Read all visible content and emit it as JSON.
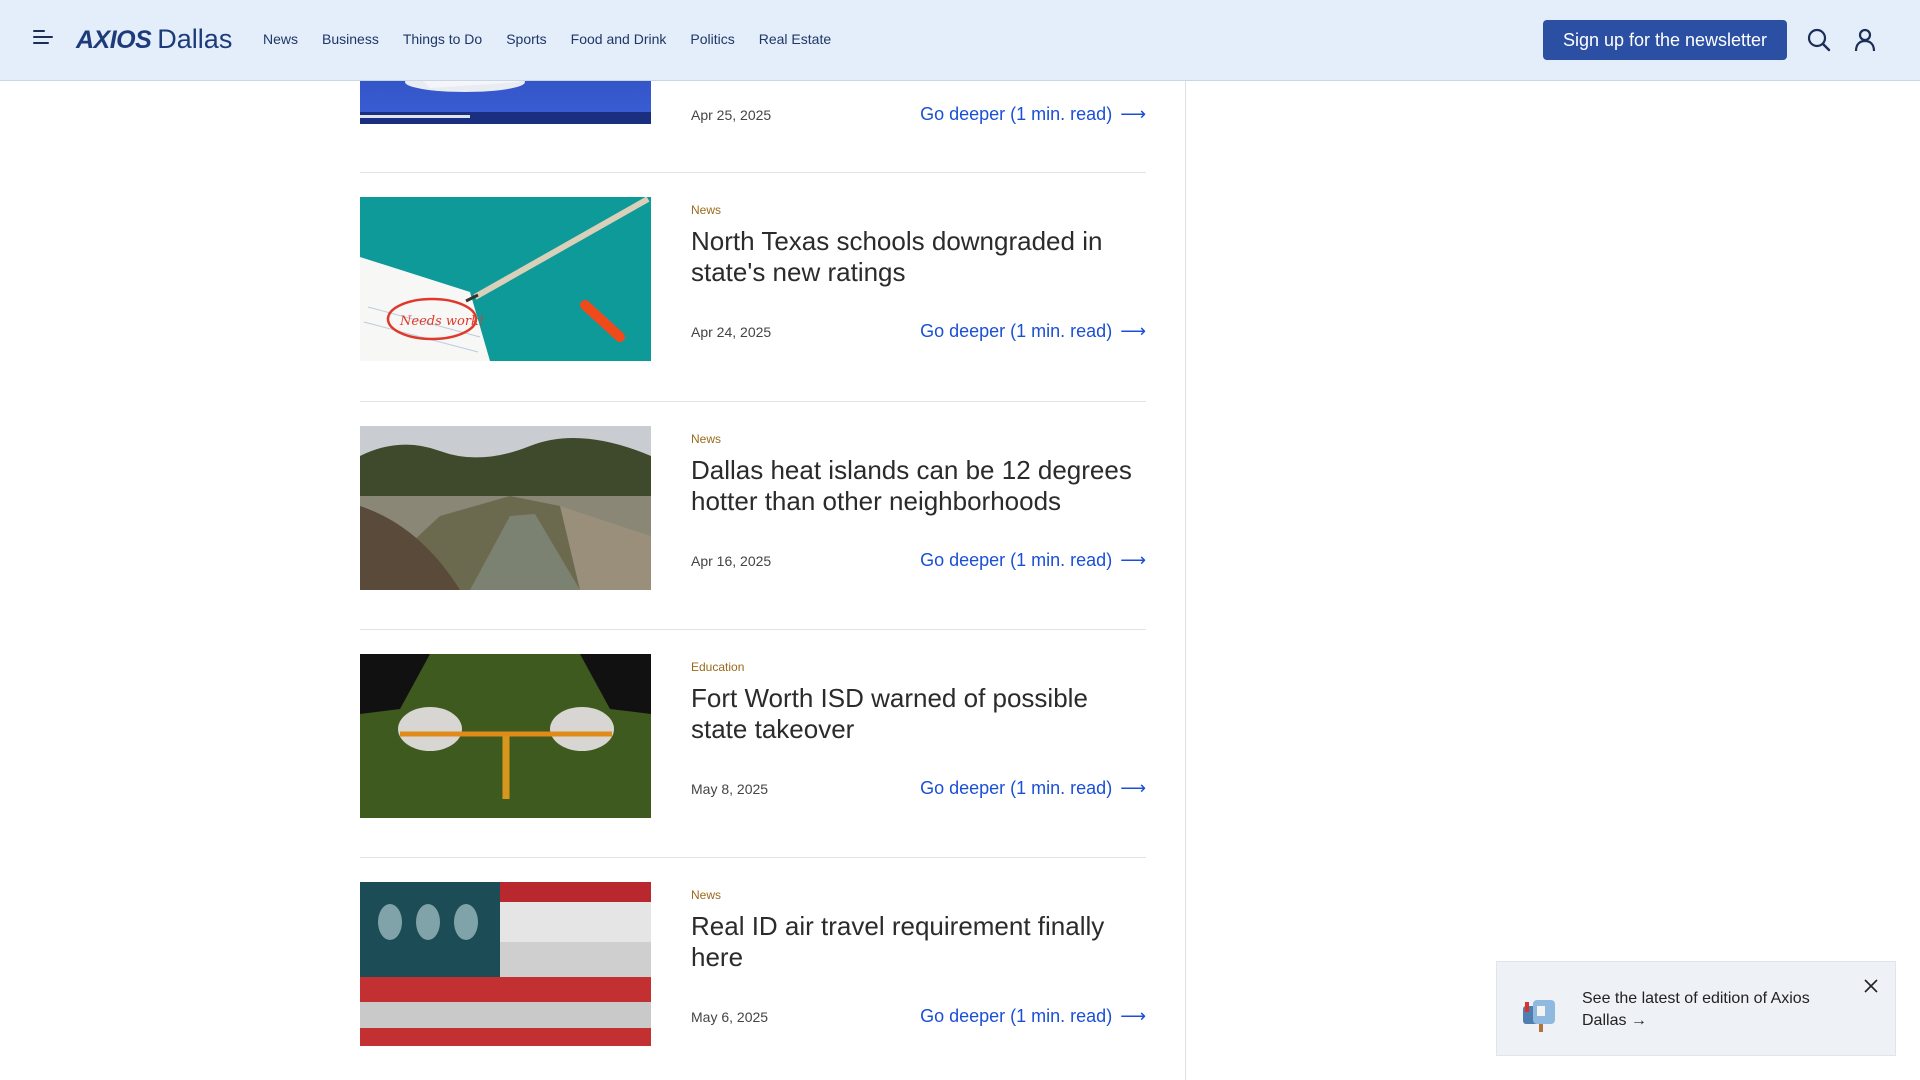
{
  "header": {
    "brand": "AXIOS",
    "city": "Dallas",
    "nav": [
      "News",
      "Business",
      "Things to Do",
      "Sports",
      "Food and Drink",
      "Politics",
      "Real Estate"
    ],
    "signup_label": "Sign up for the newsletter"
  },
  "articles": [
    {
      "category": "",
      "headline": "",
      "date": "Apr 25, 2025",
      "link": "Go deeper (1 min. read)"
    },
    {
      "category": "News",
      "headline": "North Texas schools downgraded in state's new ratings",
      "date": "Apr 24, 2025",
      "link": "Go deeper (1 min. read)"
    },
    {
      "category": "News",
      "headline": "Dallas heat islands can be 12 degrees hotter than other neighborhoods",
      "date": "Apr 16, 2025",
      "link": "Go deeper (1 min. read)"
    },
    {
      "category": "Education",
      "headline": "Fort Worth ISD warned of possible state takeover",
      "date": "May 8, 2025",
      "link": "Go deeper (1 min. read)"
    },
    {
      "category": "News",
      "headline": "Real ID air travel requirement finally here",
      "date": "May 6, 2025",
      "link": "Go deeper (1 min. read)"
    }
  ],
  "popup": {
    "text": "See the latest of edition of Axios Dallas →"
  },
  "colors": {
    "header_bg": "#e3eefa",
    "brand": "#1d3a7a",
    "cta": "#2a4fa3",
    "link": "#1a4fd6",
    "category": "#9a6a1c"
  },
  "icons": [
    "menu-icon",
    "search-icon",
    "user-icon",
    "close-icon",
    "mailbox-icon",
    "arrow-right-icon"
  ]
}
